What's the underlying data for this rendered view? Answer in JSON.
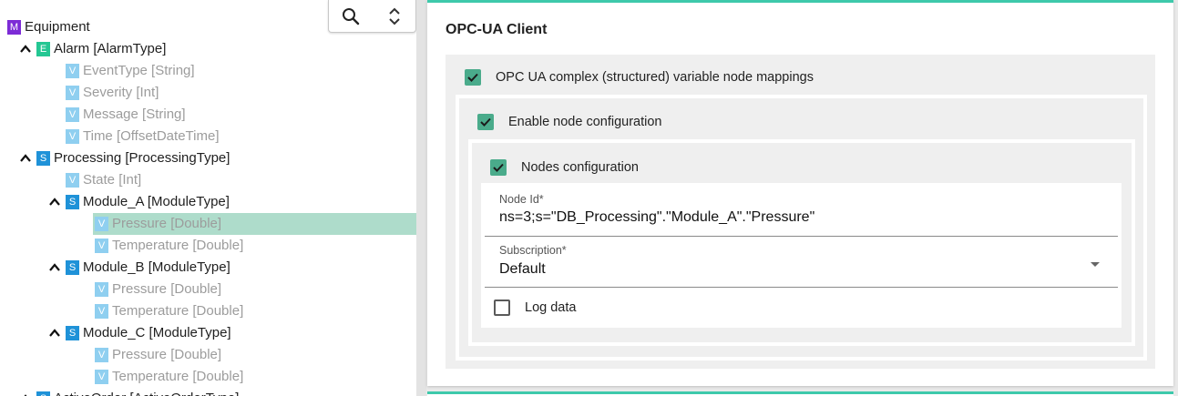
{
  "tree": {
    "toolbar": {
      "search_icon": "search-icon",
      "sort_icon": "unfold-icon"
    },
    "rows": [
      {
        "badge": "M",
        "label": "Equipment",
        "depth": 0,
        "expandable": false,
        "kind": "model"
      },
      {
        "badge": "E",
        "label": "Alarm [AlarmType]",
        "depth": 1,
        "expandable": true,
        "kind": "event"
      },
      {
        "badge": "V",
        "label": "EventType [String]",
        "depth": 2,
        "expandable": false,
        "kind": "variable"
      },
      {
        "badge": "V",
        "label": "Severity [Int]",
        "depth": 2,
        "expandable": false,
        "kind": "variable"
      },
      {
        "badge": "V",
        "label": "Message [String]",
        "depth": 2,
        "expandable": false,
        "kind": "variable"
      },
      {
        "badge": "V",
        "label": "Time [OffsetDateTime]",
        "depth": 2,
        "expandable": false,
        "kind": "variable"
      },
      {
        "badge": "S",
        "label": "Processing [ProcessingType]",
        "depth": 1,
        "expandable": true,
        "kind": "structure"
      },
      {
        "badge": "V",
        "label": "State [Int]",
        "depth": 2,
        "expandable": false,
        "kind": "variable"
      },
      {
        "badge": "S",
        "label": "Module_A [ModuleType]",
        "depth": 2,
        "expandable": true,
        "kind": "structure"
      },
      {
        "badge": "V",
        "label": "Pressure [Double]",
        "depth": 3,
        "expandable": false,
        "kind": "variable",
        "selected": true
      },
      {
        "badge": "V",
        "label": "Temperature [Double]",
        "depth": 3,
        "expandable": false,
        "kind": "variable"
      },
      {
        "badge": "S",
        "label": "Module_B [ModuleType]",
        "depth": 2,
        "expandable": true,
        "kind": "structure"
      },
      {
        "badge": "V",
        "label": "Pressure [Double]",
        "depth": 3,
        "expandable": false,
        "kind": "variable"
      },
      {
        "badge": "V",
        "label": "Temperature [Double]",
        "depth": 3,
        "expandable": false,
        "kind": "variable"
      },
      {
        "badge": "S",
        "label": "Module_C [ModuleType]",
        "depth": 2,
        "expandable": true,
        "kind": "structure"
      },
      {
        "badge": "V",
        "label": "Pressure [Double]",
        "depth": 3,
        "expandable": false,
        "kind": "variable"
      },
      {
        "badge": "V",
        "label": "Temperature [Double]",
        "depth": 3,
        "expandable": false,
        "kind": "variable"
      },
      {
        "badge": "S",
        "label": "ActiveOrder [ActiveOrderType]",
        "depth": 1,
        "expandable": true,
        "kind": "structure"
      }
    ]
  },
  "card": {
    "title": "OPC-UA Client",
    "mappings": {
      "label": "OPC UA complex (structured) variable node mappings",
      "checked": true
    },
    "enable": {
      "label": "Enable node configuration",
      "checked": true
    },
    "nodes": {
      "label": "Nodes configuration",
      "checked": true
    },
    "node_id": {
      "label": "Node Id*",
      "value": "ns=3;s=\"DB_Processing\".\"Module_A\".\"Pressure\""
    },
    "subscription": {
      "label": "Subscription*",
      "value": "Default"
    },
    "log_data": {
      "label": "Log data",
      "checked": false
    }
  },
  "colors": {
    "accent": "#3ec9ab",
    "checkbox_on": "#4aab8b",
    "selected_row": "#aedccb",
    "badge_model": "#7c2bd6",
    "badge_event": "#24c793",
    "badge_structure": "#1f92d8",
    "badge_variable": "#8fcff0"
  }
}
